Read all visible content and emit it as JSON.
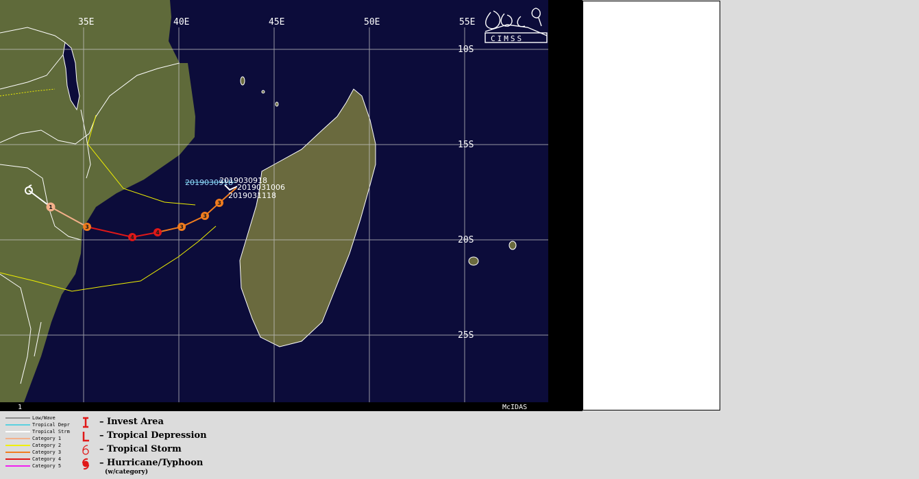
{
  "map": {
    "lon_labels": [
      "35E",
      "40E",
      "45E",
      "50E",
      "55E"
    ],
    "lat_labels": [
      "10S",
      "15S",
      "20S",
      "25S"
    ],
    "frame_number": "1",
    "credit": "McIDAS",
    "logo_text": "CIMSS",
    "date_labels": [
      "2019030918",
      "2019030918",
      "2019031006",
      "2019031118"
    ],
    "track_points": [
      {
        "category": "Tropical Storm",
        "symbol": "6"
      },
      {
        "category": "Category 1",
        "symbol": "1"
      },
      {
        "category": "Category 3",
        "symbol": "3"
      },
      {
        "category": "Category 4",
        "symbol": "4"
      },
      {
        "category": "Category 4",
        "symbol": "4"
      },
      {
        "category": "Category 3",
        "symbol": "3"
      },
      {
        "category": "Category 3",
        "symbol": "3"
      },
      {
        "category": "Category 3",
        "symbol": "3"
      }
    ],
    "colors": {
      "ocean": "#0c0c3a",
      "land": "#5f6a3a",
      "grid": "#c8c8c8",
      "border": "#ffffff",
      "cat1": "#f4b08a",
      "cat3": "#f07c1e",
      "cat4": "#e01818",
      "wind_line": "#f0f000"
    }
  },
  "legend": {
    "lines": [
      {
        "label": "Low/Wave",
        "color": "#8c8c8c"
      },
      {
        "label": "Tropical Depr",
        "color": "#5ad0e0"
      },
      {
        "label": "Tropical Strm",
        "color": "#ffffff"
      },
      {
        "label": "Category 1",
        "color": "#f4b08a"
      },
      {
        "label": "Category 2",
        "color": "#f0f000"
      },
      {
        "label": "Category 3",
        "color": "#f07c1e"
      },
      {
        "label": "Category 4",
        "color": "#e01818"
      },
      {
        "label": "Category 5",
        "color": "#f020f0"
      }
    ],
    "symbols": [
      {
        "glyph": "I",
        "label": "– Invest Area",
        "icon": "invest-area-icon"
      },
      {
        "glyph": "L",
        "label": "– Tropical Depression",
        "icon": "tropical-depression-icon"
      },
      {
        "glyph": "6",
        "label": "– Tropical Storm",
        "icon": "tropical-storm-icon"
      },
      {
        "glyph": "6",
        "label": "– Hurricane/Typhoon",
        "icon": "hurricane-icon"
      }
    ],
    "symbol_note": "(w/category)"
  }
}
